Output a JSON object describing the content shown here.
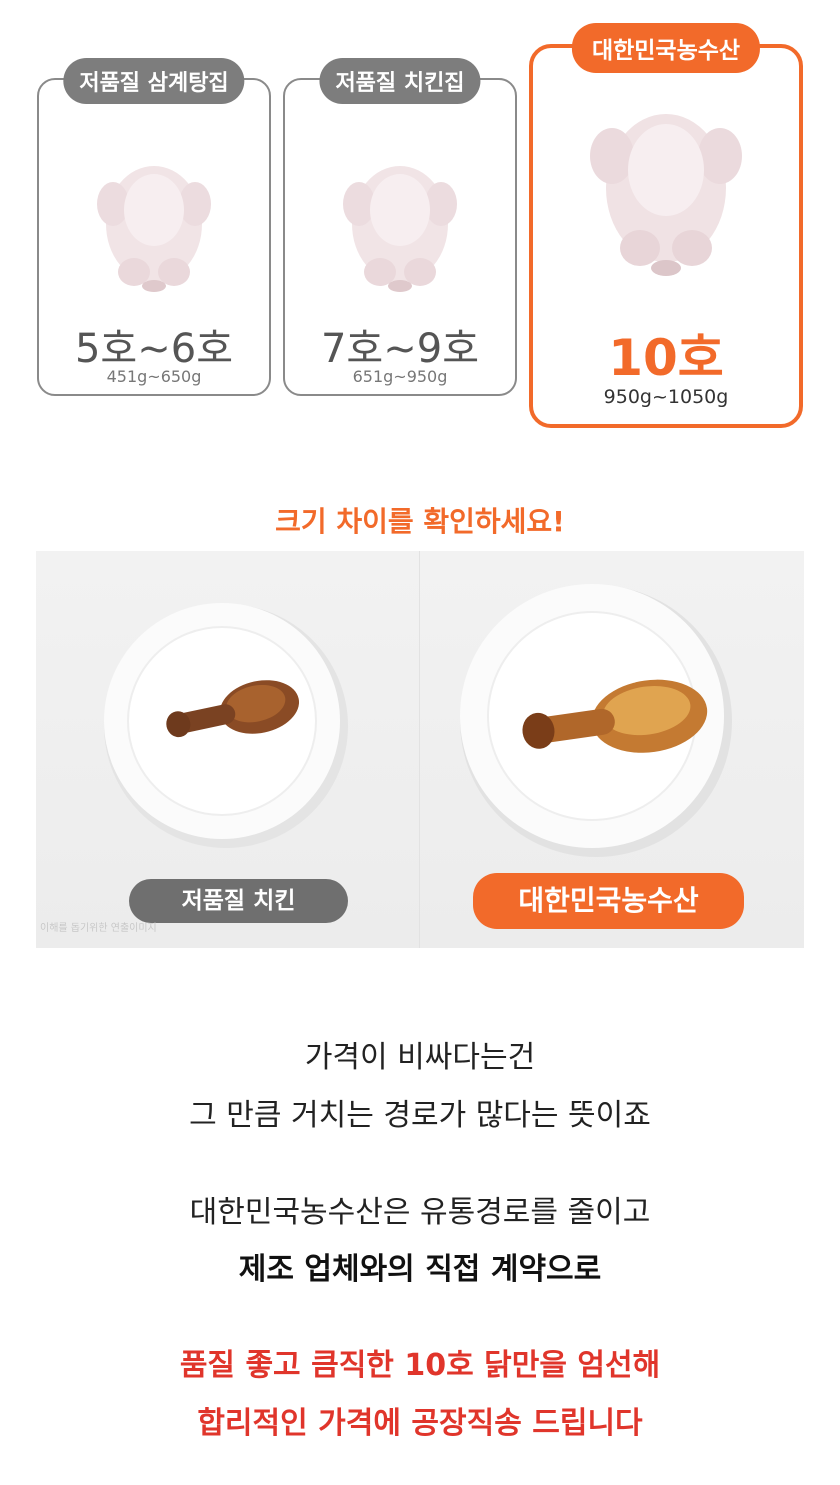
{
  "cards": [
    {
      "tag": "저품질 삼계탕집",
      "size": "5호~6호",
      "weight": "451g~650g",
      "highlight": false
    },
    {
      "tag": "저품질 치킨집",
      "size": "7호~9호",
      "weight": "651g~950g",
      "highlight": false
    },
    {
      "tag": "대한민국농수산",
      "size": "10호",
      "weight": "950g~1050g",
      "highlight": true
    }
  ],
  "compare": {
    "title": "크기 차이를 확인하세요!",
    "left_label": "저품질 치킨",
    "right_label": "대한민국농수산",
    "disclaimer": "이해를 돕기위한 연출이미지"
  },
  "copy": {
    "line1": "가격이 비싸다는건",
    "line2": "그 만큼 거치는 경로가 많다는 뜻이죠",
    "line3": "대한민국농수산은 유통경로를 줄이고",
    "line4": "제조 업체와의 직접 계약으로",
    "line5": "품질 좋고 큼직한 10호 닭만을 엄선해",
    "line6": "합리적인 가격에 공장직송 드립니다"
  },
  "colors": {
    "accent": "#f26a2a",
    "gray_tag": "#7d7d7d",
    "red_text": "#e0352b"
  }
}
